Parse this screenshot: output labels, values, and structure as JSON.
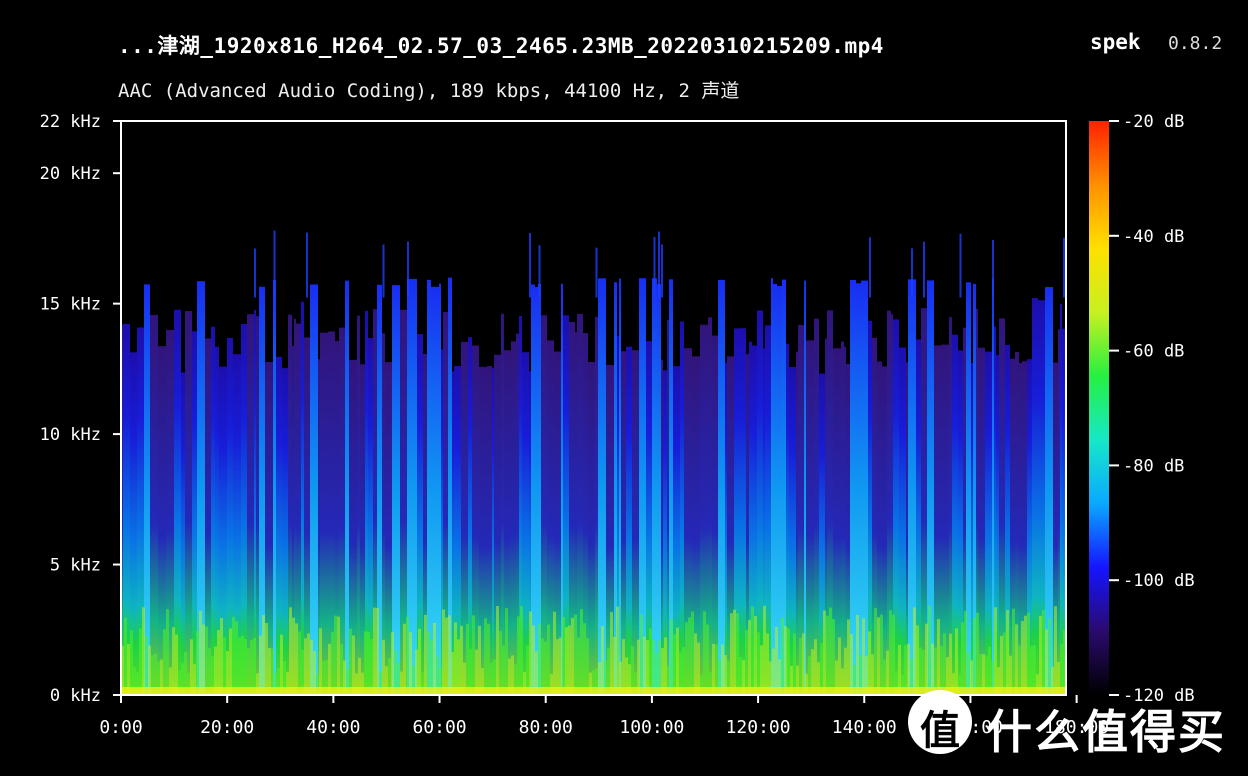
{
  "header": {
    "title": "...津湖_1920x816_H264_02.57_03_2465.23MB_20220310215209.mp4",
    "app_name": "spek",
    "app_version": "0.8.2",
    "subtitle": "AAC (Advanced Audio Coding), 189 kbps, 44100 Hz, 2 声道"
  },
  "watermark": {
    "glyph": "值",
    "text": "什么值得买"
  },
  "chart_data": {
    "type": "heatmap",
    "x_ticks": [
      "0:00",
      "20:00",
      "40:00",
      "60:00",
      "80:00",
      "100:00",
      "120:00",
      "140:00",
      "160:00",
      "180:00"
    ],
    "x_tick_minutes": [
      0,
      20,
      40,
      60,
      80,
      100,
      120,
      140,
      160,
      180
    ],
    "xlim_minutes": [
      0,
      178
    ],
    "y_ticks": [
      "0 kHz",
      "5 kHz",
      "10 kHz",
      "15 kHz",
      "20 kHz",
      "22 kHz"
    ],
    "y_tick_khz": [
      0,
      5,
      10,
      15,
      20,
      22
    ],
    "ylim_khz": [
      0,
      22
    ],
    "colorbar": {
      "ticks": [
        "-20 dB",
        "-40 dB",
        "-60 dB",
        "-80 dB",
        "-100 dB",
        "-120 dB"
      ],
      "tick_db": [
        -20,
        -40,
        -60,
        -80,
        -100,
        -120
      ],
      "range_db": [
        -120,
        -20
      ],
      "colors": [
        "#000000",
        "#2a0a6e",
        "#1515ff",
        "#0aa8ff",
        "#16e8c8",
        "#26f040",
        "#c8f020",
        "#ffe000",
        "#ff9000",
        "#ff2000"
      ]
    },
    "content_cutoff_khz": 16,
    "burst_cutoff_khz": 17.8
  }
}
